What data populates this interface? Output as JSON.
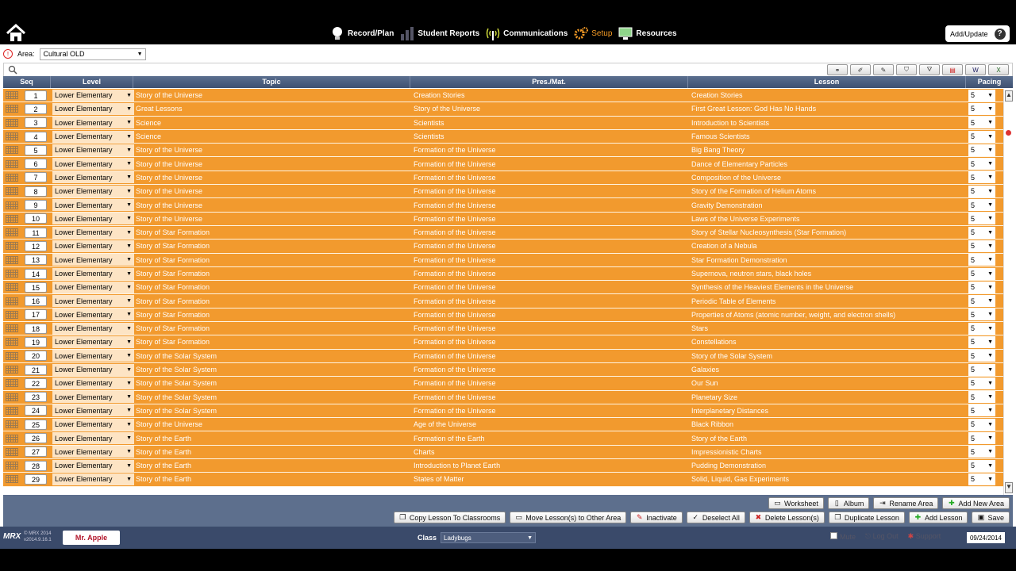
{
  "nav": {
    "items": [
      {
        "label": "Record/Plan",
        "icon": "lightbulb-icon"
      },
      {
        "label": "Student Reports",
        "icon": "bar-chart-icon"
      },
      {
        "label": "Communications",
        "icon": "antenna-icon"
      },
      {
        "label": "Setup",
        "icon": "gears-icon"
      },
      {
        "label": "Resources",
        "icon": "monitor-icon"
      }
    ],
    "add_update": "Add/Update"
  },
  "area": {
    "label": "Area:",
    "value": "Cultural OLD"
  },
  "table": {
    "headers": {
      "seq": "Seq",
      "level": "Level",
      "topic": "Topic",
      "pres": "Pres./Mat.",
      "lesson": "Lesson",
      "pacing": "Pacing"
    },
    "rows": [
      {
        "seq": "1",
        "level": "Lower Elementary",
        "topic": "Story of the Universe",
        "pres": "Creation Stories",
        "lesson": "Creation Stories",
        "pacing": "5"
      },
      {
        "seq": "2",
        "level": "Lower Elementary",
        "topic": "Great Lessons",
        "pres": "Story of the Universe",
        "lesson": "First Great Lesson: God Has No Hands",
        "pacing": "5"
      },
      {
        "seq": "3",
        "level": "Lower Elementary",
        "topic": "Science",
        "pres": "Scientists",
        "lesson": "Introduction to Scientists",
        "pacing": "5"
      },
      {
        "seq": "4",
        "level": "Lower Elementary",
        "topic": "Science",
        "pres": "Scientists",
        "lesson": "Famous Scientists",
        "pacing": "5"
      },
      {
        "seq": "5",
        "level": "Lower Elementary",
        "topic": "Story of the Universe",
        "pres": "Formation of the Universe",
        "lesson": "Big Bang Theory",
        "pacing": "5"
      },
      {
        "seq": "6",
        "level": "Lower Elementary",
        "topic": "Story of the Universe",
        "pres": "Formation of the Universe",
        "lesson": "Dance of Elementary Particles",
        "pacing": "5"
      },
      {
        "seq": "7",
        "level": "Lower Elementary",
        "topic": "Story of the Universe",
        "pres": "Formation of the Universe",
        "lesson": "Composition of the Universe",
        "pacing": "5"
      },
      {
        "seq": "8",
        "level": "Lower Elementary",
        "topic": "Story of the Universe",
        "pres": "Formation of the Universe",
        "lesson": "Story of the Formation of Helium Atoms",
        "pacing": "5"
      },
      {
        "seq": "9",
        "level": "Lower Elementary",
        "topic": "Story of the Universe",
        "pres": "Formation of the Universe",
        "lesson": "Gravity Demonstration",
        "pacing": "5"
      },
      {
        "seq": "10",
        "level": "Lower Elementary",
        "topic": "Story of the Universe",
        "pres": "Formation of the Universe",
        "lesson": "Laws of the Universe Experiments",
        "pacing": "5"
      },
      {
        "seq": "11",
        "level": "Lower Elementary",
        "topic": "Story of Star Formation",
        "pres": "Formation of the Universe",
        "lesson": "Story of Stellar Nucleosynthesis (Star Formation)",
        "pacing": "5"
      },
      {
        "seq": "12",
        "level": "Lower Elementary",
        "topic": "Story of Star Formation",
        "pres": "Formation of the Universe",
        "lesson": "Creation of a Nebula",
        "pacing": "5"
      },
      {
        "seq": "13",
        "level": "Lower Elementary",
        "topic": "Story of Star Formation",
        "pres": "Formation of the Universe",
        "lesson": "Star Formation Demonstration",
        "pacing": "5"
      },
      {
        "seq": "14",
        "level": "Lower Elementary",
        "topic": "Story of Star Formation",
        "pres": "Formation of the Universe",
        "lesson": "Supernova, neutron stars, black holes",
        "pacing": "5"
      },
      {
        "seq": "15",
        "level": "Lower Elementary",
        "topic": "Story of Star Formation",
        "pres": "Formation of the Universe",
        "lesson": "Synthesis of the Heaviest Elements in the Universe",
        "pacing": "5"
      },
      {
        "seq": "16",
        "level": "Lower Elementary",
        "topic": "Story of Star Formation",
        "pres": "Formation of the Universe",
        "lesson": "Periodic Table of Elements",
        "pacing": "5"
      },
      {
        "seq": "17",
        "level": "Lower Elementary",
        "topic": "Story of Star Formation",
        "pres": "Formation of the Universe",
        "lesson": "Properties of Atoms (atomic number, weight, and electron shells)",
        "pacing": "5"
      },
      {
        "seq": "18",
        "level": "Lower Elementary",
        "topic": "Story of Star Formation",
        "pres": "Formation of the Universe",
        "lesson": "Stars",
        "pacing": "5"
      },
      {
        "seq": "19",
        "level": "Lower Elementary",
        "topic": "Story of Star Formation",
        "pres": "Formation of the Universe",
        "lesson": "Constellations",
        "pacing": "5"
      },
      {
        "seq": "20",
        "level": "Lower Elementary",
        "topic": "Story of the Solar System",
        "pres": "Formation of the Universe",
        "lesson": "Story of the Solar System",
        "pacing": "5"
      },
      {
        "seq": "21",
        "level": "Lower Elementary",
        "topic": "Story of the Solar System",
        "pres": "Formation of the Universe",
        "lesson": "Galaxies",
        "pacing": "5"
      },
      {
        "seq": "22",
        "level": "Lower Elementary",
        "topic": "Story of the Solar System",
        "pres": "Formation of the Universe",
        "lesson": "Our Sun",
        "pacing": "5"
      },
      {
        "seq": "23",
        "level": "Lower Elementary",
        "topic": "Story of the Solar System",
        "pres": "Formation of the Universe",
        "lesson": "Planetary Size",
        "pacing": "5"
      },
      {
        "seq": "24",
        "level": "Lower Elementary",
        "topic": "Story of the Solar System",
        "pres": "Formation of the Universe",
        "lesson": "Interplanetary Distances",
        "pacing": "5"
      },
      {
        "seq": "25",
        "level": "Lower Elementary",
        "topic": "Story of the Universe",
        "pres": "Age of the Universe",
        "lesson": " Black Ribbon",
        "pacing": "5"
      },
      {
        "seq": "26",
        "level": "Lower Elementary",
        "topic": "Story of the Earth",
        "pres": "Formation of the Earth",
        "lesson": "Story of the Earth",
        "pacing": "5"
      },
      {
        "seq": "27",
        "level": "Lower Elementary",
        "topic": "Story of the Earth",
        "pres": "Charts",
        "lesson": "Impressionistic Charts",
        "pacing": "5"
      },
      {
        "seq": "28",
        "level": "Lower Elementary",
        "topic": "Story of the Earth",
        "pres": "Introduction to Planet Earth",
        "lesson": "Pudding Demonstration",
        "pacing": "5"
      },
      {
        "seq": "29",
        "level": "Lower Elementary",
        "topic": "Story of the Earth",
        "pres": "States of Matter",
        "lesson": "Solid, Liquid, Gas Experiments",
        "pacing": "5"
      }
    ]
  },
  "buttons": {
    "row1": [
      "Worksheet",
      "Album",
      "Rename Area",
      "Add New Area"
    ],
    "row2": [
      "Copy Lesson To Classrooms",
      "Move Lesson(s) to Other Area",
      "Inactivate",
      "Deselect All",
      "Delete Lesson(s)",
      "Duplicate Lesson",
      "Add Lesson",
      "Save"
    ]
  },
  "footer": {
    "logo": "MRX",
    "copyright_line1": "© MRX 2014",
    "copyright_line2": "v2014.9.16.1",
    "user": "Mr. Apple",
    "class_label": "Class",
    "class_value": "Ladybugs",
    "mute": "Mute",
    "logout": "Log Out",
    "support": "Support",
    "date": "09/24/2014"
  }
}
